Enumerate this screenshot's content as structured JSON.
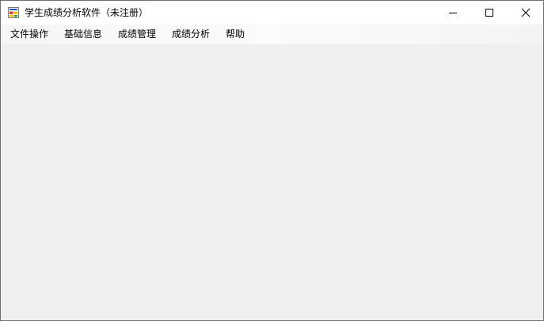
{
  "window": {
    "title": "学生成绩分析软件（未注册）",
    "icon": "app-window-icon"
  },
  "window_controls": {
    "minimize_icon": "minimize-icon",
    "maximize_icon": "maximize-icon",
    "close_icon": "close-icon"
  },
  "menubar": {
    "items": [
      {
        "label": "文件操作"
      },
      {
        "label": "基础信息"
      },
      {
        "label": "成绩管理"
      },
      {
        "label": "成绩分析"
      },
      {
        "label": "帮助"
      }
    ]
  },
  "colors": {
    "client_background": "#efefef",
    "titlebar_background": "#ffffff",
    "window_border": "#6f6f6f"
  }
}
